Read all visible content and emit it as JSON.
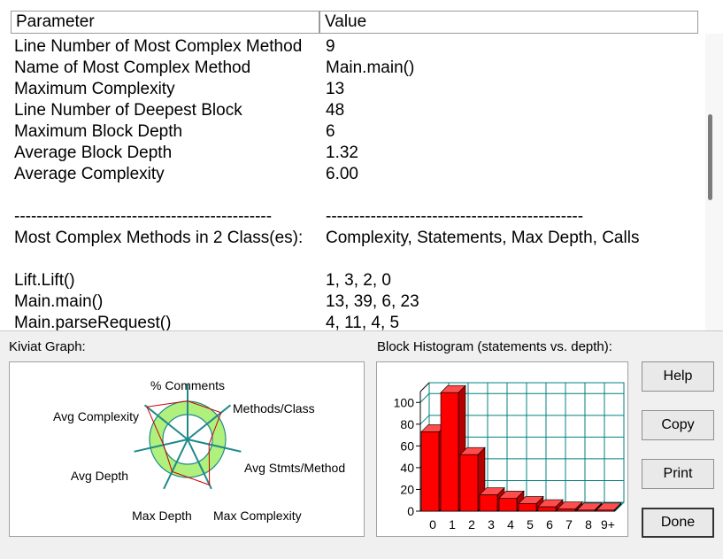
{
  "table": {
    "headers": {
      "parameter": "Parameter",
      "value": "Value"
    },
    "rows": [
      [
        "Line Number of Most Complex Method",
        "9"
      ],
      [
        "Name of Most Complex Method",
        "Main.main()"
      ],
      [
        "Maximum Complexity",
        "13"
      ],
      [
        "Line Number of Deepest Block",
        "48"
      ],
      [
        "Maximum Block Depth",
        "6"
      ],
      [
        "Average Block Depth",
        "1.32"
      ],
      [
        "Average Complexity",
        "6.00"
      ],
      [
        "",
        ""
      ],
      [
        "----------------------------------------------",
        "----------------------------------------------"
      ],
      [
        "Most Complex Methods in 2 Class(es):",
        "Complexity, Statements, Max Depth, Calls"
      ],
      [
        "",
        ""
      ],
      [
        "Lift.Lift()",
        "1, 3, 2, 0"
      ],
      [
        "Main.main()",
        "13, 39, 6, 23"
      ],
      [
        "Main.parseRequest()",
        "4, 11, 4, 5"
      ]
    ]
  },
  "kiviat": {
    "label": "Kiviat Graph:",
    "axes": [
      "% Comments",
      "Methods/Class",
      "Avg Stmts/Method",
      "Max Complexity",
      "Max Depth",
      "Avg Depth",
      "Avg Complexity"
    ]
  },
  "histogram": {
    "label": "Block Histogram (statements vs. depth):"
  },
  "buttons": {
    "help": "Help",
    "copy": "Copy",
    "print": "Print",
    "done": "Done"
  },
  "chart_data": [
    {
      "type": "bar",
      "title": "Block Histogram (statements vs. depth):",
      "categories": [
        "0",
        "1",
        "2",
        "3",
        "4",
        "5",
        "6",
        "7",
        "8",
        "9+"
      ],
      "values": [
        73,
        109,
        52,
        15,
        12,
        7,
        4,
        2,
        1,
        1
      ],
      "ylim": [
        0,
        110
      ],
      "yticks": [
        0,
        20,
        40,
        60,
        80,
        100
      ],
      "grid": true,
      "bar_color": "#ff0000",
      "grid_color": "#008080"
    }
  ]
}
